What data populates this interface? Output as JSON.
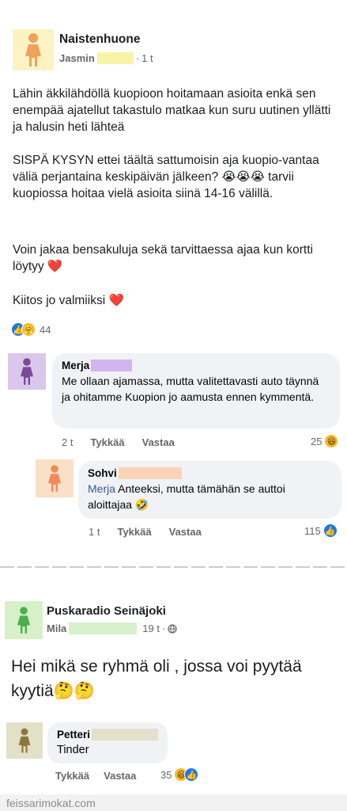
{
  "post1": {
    "group_name": "Naistenhuone",
    "author": "Jasmin",
    "time": "1 t",
    "paragraphs": [
      "Lähin äkkilähdöllä kuopioon hoitamaan asioita enkä sen enempää ajatellut takastulo matkaa kun suru uutinen yllätti ja halusin heti lähteä",
      "SISPÄ KYSYN ettei täältä sattumoisin aja kuopio-vantaa väliä perjantaina keskipäivän jälkeen? 😭😭😭 tarvii kuopiossa hoitaa vielä asioita siinä 14-16 välillä.",
      "Voin jakaa bensakuluja sekä tarvittaessa ajaa kun kortti löytyy ❤️",
      "Kiitos jo valmiiksi ❤️"
    ],
    "reaction_count": "44",
    "colors": {
      "avatar_bg": "#fbf3c4",
      "avatar_figure": "#f0a15a",
      "redact": "#f7f3a8"
    }
  },
  "comment1": {
    "author": "Merja",
    "text": "Me ollaan ajamassa, mutta valitettavasti auto täynnä ja ohitamme Kuopion jo aamusta ennen kymmentä.",
    "time": "2 t",
    "like_label": "Tykkää",
    "reply_label": "Vastaa",
    "reaction_count": "25",
    "colors": {
      "avatar_bg": "#d9c8ec",
      "avatar_figure": "#7a4a9a",
      "redact": "#d3b4ec"
    }
  },
  "reply1": {
    "author": "Sohvi",
    "mention": "Merja",
    "text": "Anteeksi, mutta tämähän se auttoi aloittajaa 🤣",
    "time": "1 t",
    "like_label": "Tykkää",
    "reply_label": "Vastaa",
    "reaction_count": "115",
    "colors": {
      "avatar_bg": "#fbe0c8",
      "avatar_figure": "#f08a5a",
      "redact": "#fbd3b8"
    }
  },
  "post2": {
    "group_name": "Puskaradio Seinäjoki",
    "author": "Mila",
    "time": "19 t",
    "text": "Hei mikä se ryhmä oli , jossa voi pyytää kyytiä🤔🤔",
    "colors": {
      "avatar_bg": "#d8f0c8",
      "avatar_figure": "#4caf50",
      "redact": "#d6f0cc"
    }
  },
  "comment2": {
    "author": "Petteri",
    "text": "Tinder",
    "like_label": "Tykkää",
    "reply_label": "Vastaa",
    "reaction_count": "35",
    "colors": {
      "avatar_bg": "#e3e0c8",
      "avatar_figure": "#8a7a3a",
      "redact": "#e4e0cc"
    }
  },
  "watermark": "feissarimokat.com",
  "icons": [
    "person-avatar-icon",
    "globe-icon",
    "like-reaction-icon",
    "haha-reaction-icon",
    "care-reaction-icon"
  ]
}
